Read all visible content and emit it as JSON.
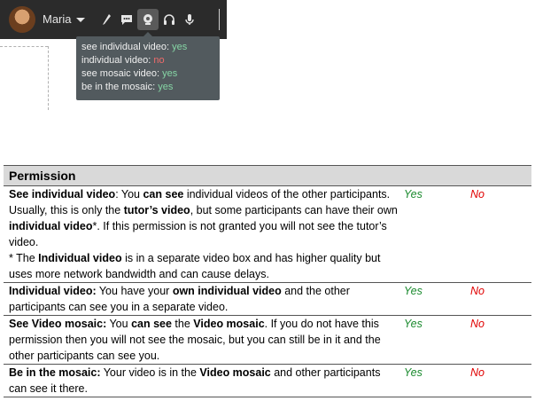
{
  "toolbar": {
    "user_name": "Maria",
    "icons": [
      "user-avatar",
      "chevron-down-icon",
      "brush-icon",
      "chat-icon",
      "webcam-icon",
      "headphones-icon",
      "microphone-icon"
    ]
  },
  "tooltip": {
    "lines": [
      {
        "label": "see individual video:",
        "value": "yes",
        "state": "yes"
      },
      {
        "label": "individual video:",
        "value": "no",
        "state": "no"
      },
      {
        "label": "see mosaic video:",
        "value": "yes",
        "state": "yes"
      },
      {
        "label": "be in the mosaic:",
        "value": "yes",
        "state": "yes"
      }
    ]
  },
  "table": {
    "header": "Permission",
    "yes_label": "Yes",
    "no_label": "No",
    "rows": [
      {
        "p1_bold": "See individual video",
        "p1_rest": ": You ",
        "p1_bold2": "can see",
        "p1_rest2": " individual videos of the other participants. Usually, this is only the ",
        "p1_bold3": "tutor’s video",
        "p1_rest3": ", but some participants can have their own ",
        "p1_bold4": "individual video",
        "p1_rest4": "*. If this permission is not granted you will not see the tutor’s video.",
        "note_prefix": "* The ",
        "note_bold": "Individual video",
        "note_rest": " is in a separate video box and has higher quality but uses more network bandwidth and can cause delays."
      },
      {
        "p1_bold": "Individual video:",
        "p1_rest": " You have your ",
        "p1_bold2": "own individual video",
        "p1_rest2": " and the other participants can see you in a separate video."
      },
      {
        "p1_bold": "See Video mosaic:",
        "p1_rest": " You ",
        "p1_bold2": "can see",
        "p1_rest2": " the ",
        "p1_bold3": "Video mosaic",
        "p1_rest3": ". If you do not have this permission then you will not see the mosaic, but you can still be in it and the other participants can see you."
      },
      {
        "p1_bold": "Be in the mosaic:",
        "p1_rest": " Your video is in the ",
        "p1_bold2": "Video mosaic",
        "p1_rest2": " and other participants can see it there."
      }
    ]
  },
  "colors": {
    "toolbar_bg": "#2b2b2b",
    "tooltip_bg": "#525a5e",
    "yes": "#1a8a2e",
    "no": "#e00000"
  }
}
